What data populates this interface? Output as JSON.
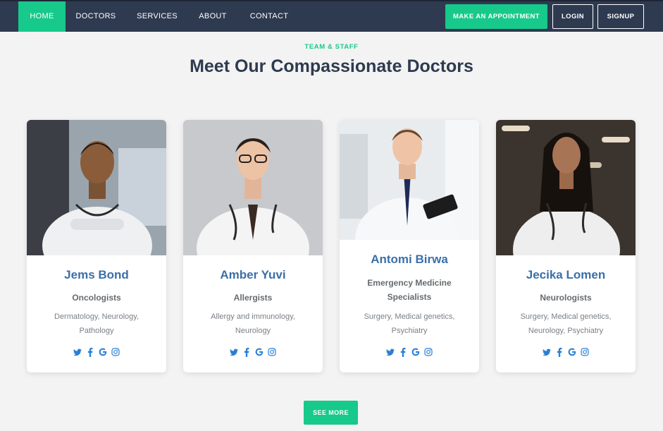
{
  "nav": {
    "items": [
      {
        "label": "HOME",
        "active": true
      },
      {
        "label": "DOCTORS",
        "active": false
      },
      {
        "label": "SERVICES",
        "active": false
      },
      {
        "label": "ABOUT",
        "active": false
      },
      {
        "label": "CONTACT",
        "active": false
      }
    ],
    "appointment_label": "MAKE AN APPOINTMENT",
    "login_label": "LOGIN",
    "signup_label": "SIGNUP"
  },
  "section": {
    "eyebrow": "TEAM & STAFF",
    "title": "Meet Our Compassionate Doctors"
  },
  "doctors": [
    {
      "name": "Jems Bond",
      "specialty": "Oncologists",
      "areas": "Dermatology, Neurology, Pathology",
      "socials": [
        "twitter-icon",
        "facebook-icon",
        "google-icon",
        "instagram-icon"
      ]
    },
    {
      "name": "Amber Yuvi",
      "specialty": "Allergists",
      "areas": "Allergy and immunology, Neurology",
      "socials": [
        "twitter-icon",
        "facebook-icon",
        "google-icon",
        "instagram-icon"
      ]
    },
    {
      "name": "Antomi Birwa",
      "specialty": "Emergency Medicine Specialists",
      "areas": "Surgery, Medical genetics, Psychiatry",
      "socials": [
        "twitter-icon",
        "facebook-icon",
        "google-icon",
        "instagram-icon"
      ]
    },
    {
      "name": "Jecika Lomen",
      "specialty": "Neurologists",
      "areas": "Surgery, Medical genetics, Neurology, Psychiatry",
      "socials": [
        "twitter-icon",
        "facebook-icon",
        "google-icon",
        "instagram-icon"
      ]
    }
  ],
  "see_more_label": "SEE MORE",
  "colors": {
    "accent": "#17c98a",
    "nav_bg": "#2e3a4f",
    "name_blue": "#3a6fa8",
    "social_blue": "#2a7fd4",
    "page_bg": "#f3f3f3"
  }
}
